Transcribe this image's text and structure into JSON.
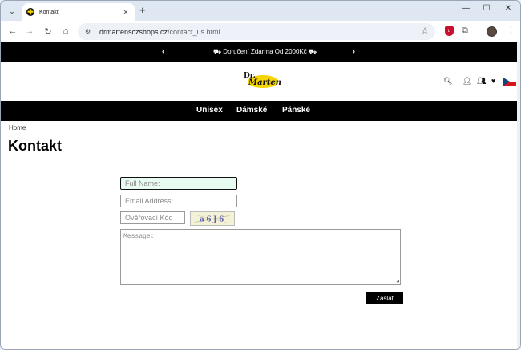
{
  "browser": {
    "tab_title": "Kontakt",
    "tab_close": "✕",
    "new_tab": "+",
    "url_host": "drmartensczshops.cz",
    "url_path": "/contact_us.html",
    "favicon_glyph": "✚"
  },
  "promo": {
    "prev": "‹",
    "next": "›",
    "text": "⛟ Doručení Zdarma Od 2000Kč ⛟"
  },
  "header": {
    "logo_alt": "Dr. Martens",
    "logo_line1": "Dr.",
    "logo_line2": "Martens",
    "flag_colors": [
      "#ffffff",
      "#d7141a",
      "#11457e"
    ]
  },
  "nav": {
    "items": [
      "Unisex",
      "Dámské",
      "Pánské"
    ]
  },
  "breadcrumb": "Home",
  "page_title": "Kontakt",
  "form": {
    "full_name_placeholder": "Full Name:",
    "email_placeholder": "Email Address:",
    "verify_placeholder": "Ověřovací Kód",
    "captcha_text": "a6J6",
    "message_placeholder": "Message:",
    "submit_label": "Zaslat"
  },
  "colors": {
    "brand_yellow": "#f5d400",
    "active_field_bg": "#e8fbf1"
  }
}
